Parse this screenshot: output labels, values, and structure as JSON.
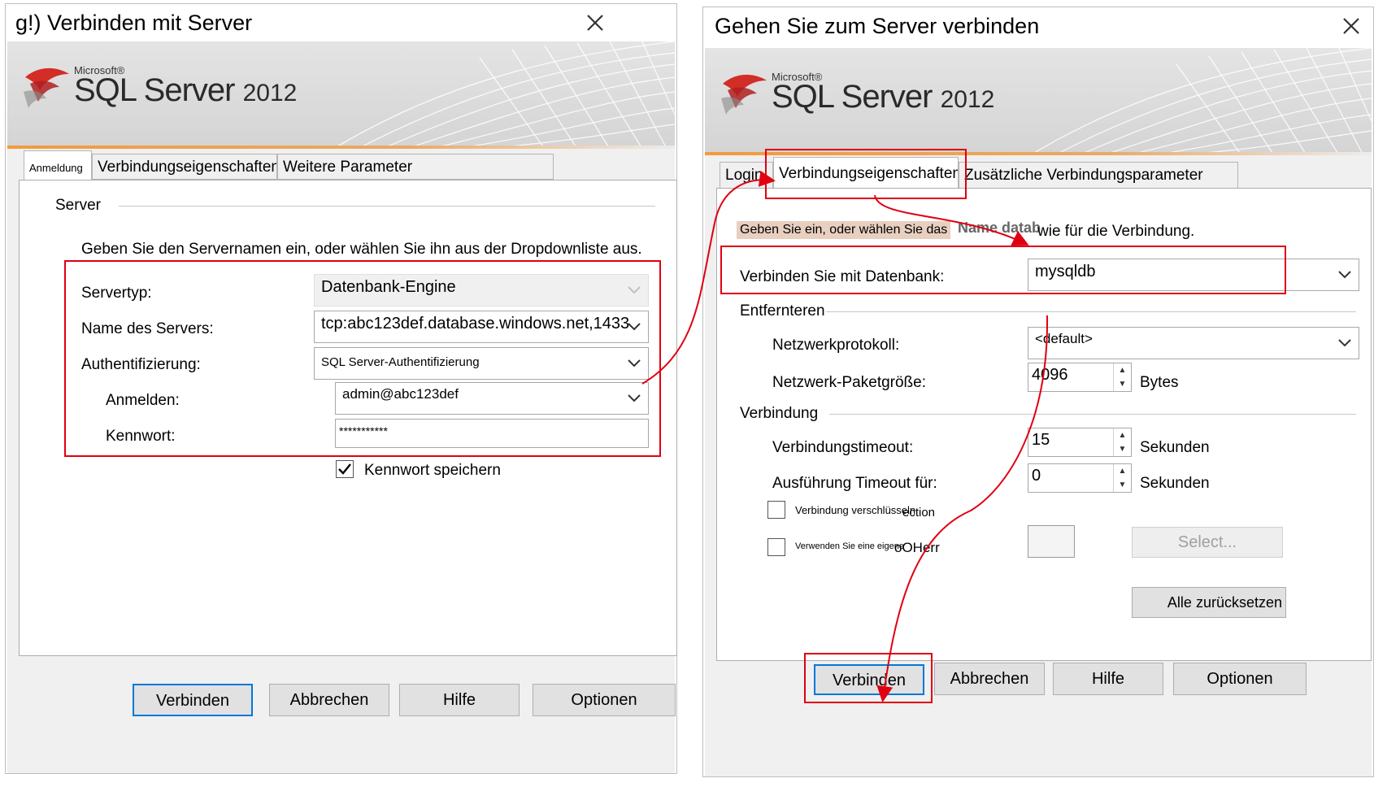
{
  "left_dialog": {
    "title": "g!) Verbinden mit Server",
    "banner": {
      "microsoft": "Microsoft®",
      "product": "SQL Server",
      "version": "2012"
    },
    "tabs": [
      {
        "label": "Anmeldung",
        "active": true
      },
      {
        "label": "Verbindungseigenschaften",
        "active": false
      },
      {
        "label": "Weitere Parameter",
        "active": false
      }
    ],
    "group_server": "Server",
    "instruction": "Geben Sie den Servernamen ein, oder wählen Sie ihn aus der Dropdownliste aus.",
    "fields": {
      "server_type_label": "Servertyp:",
      "server_type_value": "Datenbank-Engine",
      "server_name_label": "Name des Servers:",
      "server_name_value": "tcp:abc123def.database.windows.net,1433",
      "auth_label": "Authentifizierung:",
      "auth_value": "SQL Server-Authentifizierung",
      "login_label": "Anmelden:",
      "login_value": "admin@abc123def",
      "password_label": "Kennwort:",
      "password_value": "***********"
    },
    "remember_password": {
      "label": "Kennwort speichern",
      "checked": true
    },
    "buttons": {
      "connect": "Verbinden",
      "cancel": "Abbrechen",
      "help": "Hilfe",
      "options": "Optionen"
    }
  },
  "right_dialog": {
    "title": "Gehen Sie zum Server verbinden",
    "banner": {
      "microsoft": "Microsoft®",
      "product": "SQL Server",
      "version": "2012"
    },
    "tabs": [
      {
        "label": "Login",
        "active": false
      },
      {
        "label": "Verbindungseigenschaften",
        "active": true
      },
      {
        "label": "Zusätzliche Verbindungsparameter",
        "active": false
      }
    ],
    "instruction_highlight": "Geben Sie ein, oder wählen Sie das",
    "instruction_overlap": "Name datab",
    "instruction_rest": "wie für die Verbindung.",
    "connect_db_label": "Verbinden Sie mit Datenbank:",
    "connect_db_value": "mysqldb",
    "group_network": "Entfernteren",
    "network_protocol_label": "Netzwerkprotokoll:",
    "network_protocol_value": "<default>",
    "packet_size_label": "Netzwerk-Paketgröße:",
    "packet_size_value": "4096",
    "packet_size_unit": "Bytes",
    "group_connection": "Verbindung",
    "timeout_label": "Verbindungstimeout:",
    "timeout_value": "15",
    "timeout_unit": "Sekunden",
    "exec_timeout_label": "Ausführung Timeout für:",
    "exec_timeout_value": "0",
    "exec_timeout_unit": "Sekunden",
    "encrypt_label": "Verbindung verschlüsseln",
    "encrypt_overlap": "ection",
    "custom_color_label": "Verwenden Sie eine eigene",
    "custom_color_overlap": "oOHerr",
    "select_button": "Select...",
    "reset_button": "Alle zurücksetzen",
    "buttons": {
      "connect": "Verbinden",
      "cancel": "Abbrechen",
      "help": "Hilfe",
      "options": "Optionen"
    }
  },
  "colors": {
    "highlight_red": "#e00010",
    "default_button_border": "#0078d7",
    "instruction_highlight_bg": "#e8cfc0"
  }
}
